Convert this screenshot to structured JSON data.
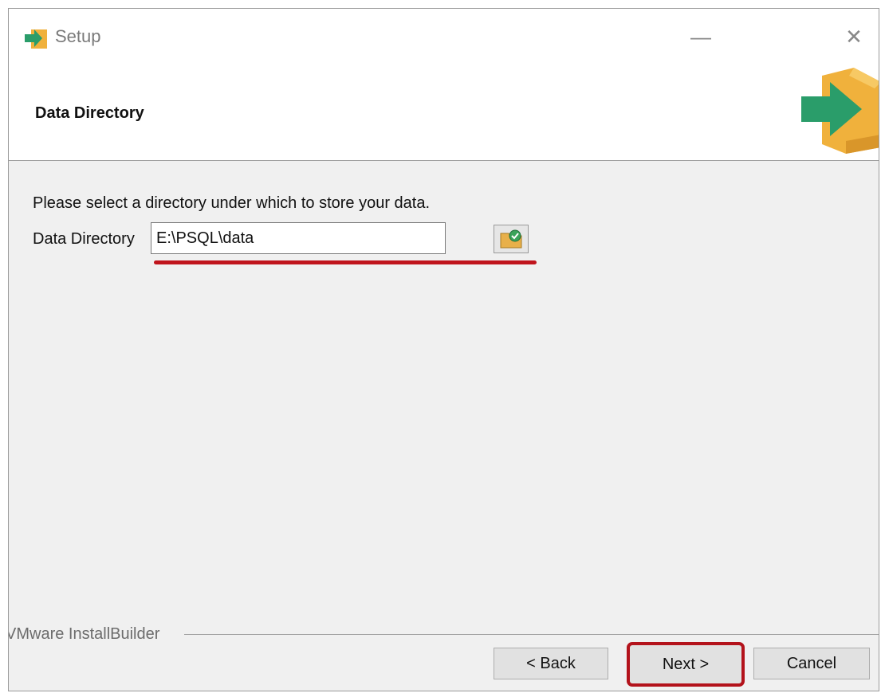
{
  "window": {
    "title": "Setup",
    "minimize_glyph": "—",
    "close_glyph": "✕"
  },
  "header": {
    "title": "Data Directory",
    "logo_icon": "installer-arrow-box-icon"
  },
  "content": {
    "prompt": "Please select a directory under which to store your data.",
    "field_label": "Data Directory",
    "field_value": "E:\\PSQL\\data",
    "browse_icon": "folder-browse-icon"
  },
  "footer": {
    "brand": "VMware InstallBuilder",
    "back_label": "< Back",
    "next_label": "Next >",
    "cancel_label": "Cancel"
  },
  "colors": {
    "annotation_red": "#c0141c",
    "arrow_green": "#2a9d6a",
    "box_yellow": "#f0b13c"
  }
}
